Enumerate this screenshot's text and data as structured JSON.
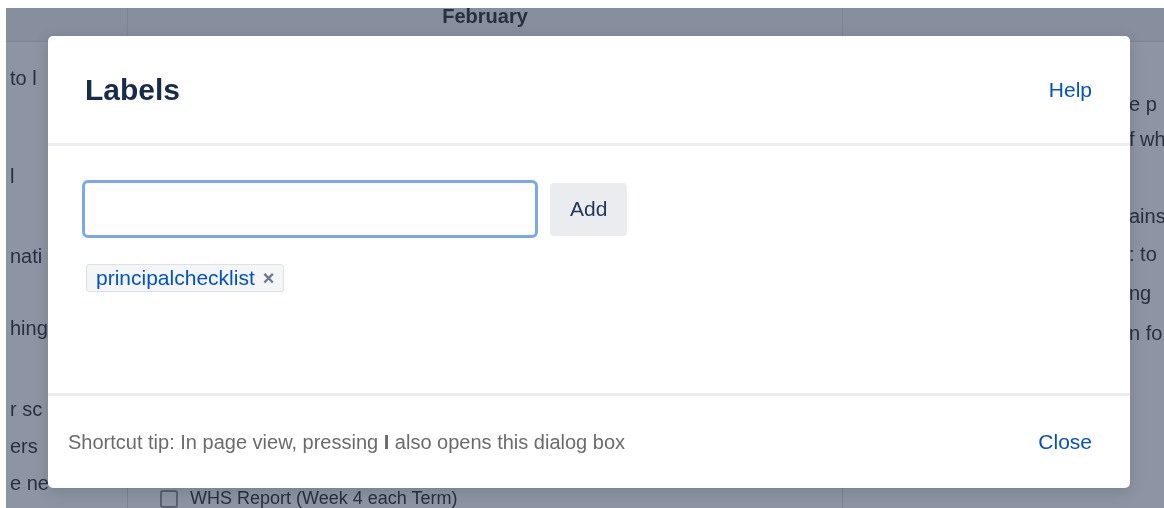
{
  "background_page": {
    "table_header": {
      "column_2": "February"
    },
    "left_column_fragments": [
      "to l",
      "l",
      "nati",
      "hing",
      "r sc",
      "ers",
      "e ne"
    ],
    "right_column_fragments": [
      "e p",
      "f wh",
      "ains",
      ": to",
      "ng",
      "n fo"
    ],
    "checklist_item": {
      "label": "WHS Report (Week 4 each Term)",
      "checked": false
    }
  },
  "dialog": {
    "title": "Labels",
    "help_link": "Help",
    "add_button": "Add",
    "labels": [
      {
        "text": "principalchecklist",
        "remove": "×"
      }
    ],
    "footer_tip": "Shortcut tip: In page view, pressing **I** also opens this dialog box",
    "close_link": "Close"
  }
}
